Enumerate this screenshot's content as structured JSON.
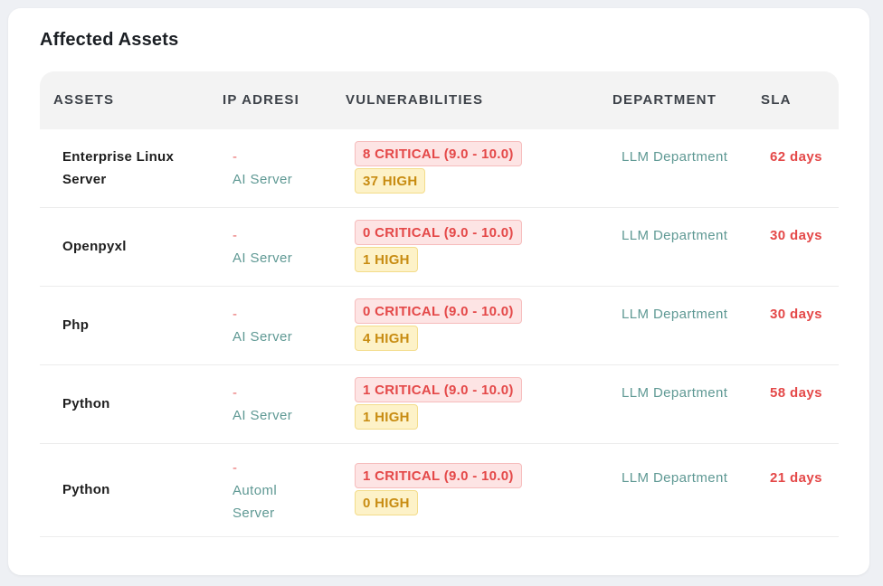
{
  "title": "Affected Assets",
  "columns": {
    "assets": "ASSETS",
    "ip": "IP ADRESI",
    "vulnerabilities": "VULNERABILITIES",
    "department": "DEPARTMENT",
    "sla": "SLA"
  },
  "rows": [
    {
      "asset": "Enterprise Linux Server",
      "ip_dash": "-",
      "ip_name": "AI Server",
      "critical": "8 CRITICAL (9.0 - 10.0)",
      "high": "37 HIGH",
      "department": "LLM Department",
      "sla": "62 days"
    },
    {
      "asset": "Openpyxl",
      "ip_dash": "-",
      "ip_name": "AI Server",
      "critical": "0 CRITICAL (9.0 - 10.0)",
      "high": "1 HIGH",
      "department": "LLM Department",
      "sla": "30 days"
    },
    {
      "asset": "Php",
      "ip_dash": "-",
      "ip_name": "AI Server",
      "critical": "0 CRITICAL (9.0 - 10.0)",
      "high": "4 HIGH",
      "department": "LLM Department",
      "sla": "30 days"
    },
    {
      "asset": "Python",
      "ip_dash": "-",
      "ip_name": "AI Server",
      "critical": "1 CRITICAL (9.0 - 10.0)",
      "high": "1 HIGH",
      "department": "LLM Department",
      "sla": "58 days"
    },
    {
      "asset": "Python",
      "ip_dash": "-",
      "ip_name": "Automl Server",
      "critical": "1 CRITICAL (9.0 - 10.0)",
      "high": "0 HIGH",
      "department": "LLM Department",
      "sla": "21 days"
    }
  ],
  "colors": {
    "critical_text": "#e44848",
    "critical_bg": "#fde4e4",
    "high_text": "#c88c12",
    "high_bg": "#fdf2c8",
    "muted_teal": "#5f9994"
  }
}
